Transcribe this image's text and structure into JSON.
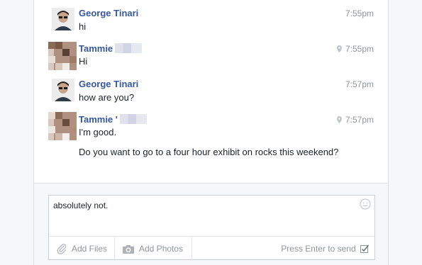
{
  "messages": [
    {
      "sender": "George Tinari",
      "time": "7:55pm",
      "texts": [
        "hi"
      ],
      "location": false
    },
    {
      "sender": "Tammie",
      "time": "7:55pm",
      "texts": [
        "Hi"
      ],
      "location": true
    },
    {
      "sender": "George Tinari",
      "time": "7:57pm",
      "texts": [
        "how are you?"
      ],
      "location": false
    },
    {
      "sender": "Tammie '",
      "time": "7:57pm",
      "texts": [
        "I'm good.",
        "Do you want to go to a four hour exhibit on rocks this weekend?"
      ],
      "location": true
    }
  ],
  "composer": {
    "value": "absolutely not.",
    "add_files": "Add Files",
    "add_photos": "Add Photos",
    "send_hint": "Press Enter to send"
  },
  "colors": {
    "name": "#365899",
    "meta": "#90949c",
    "text": "#1d2129"
  },
  "icons": [
    "smiley-icon",
    "paperclip-icon",
    "camera-icon",
    "checkbox-icon",
    "location-pin-icon"
  ]
}
